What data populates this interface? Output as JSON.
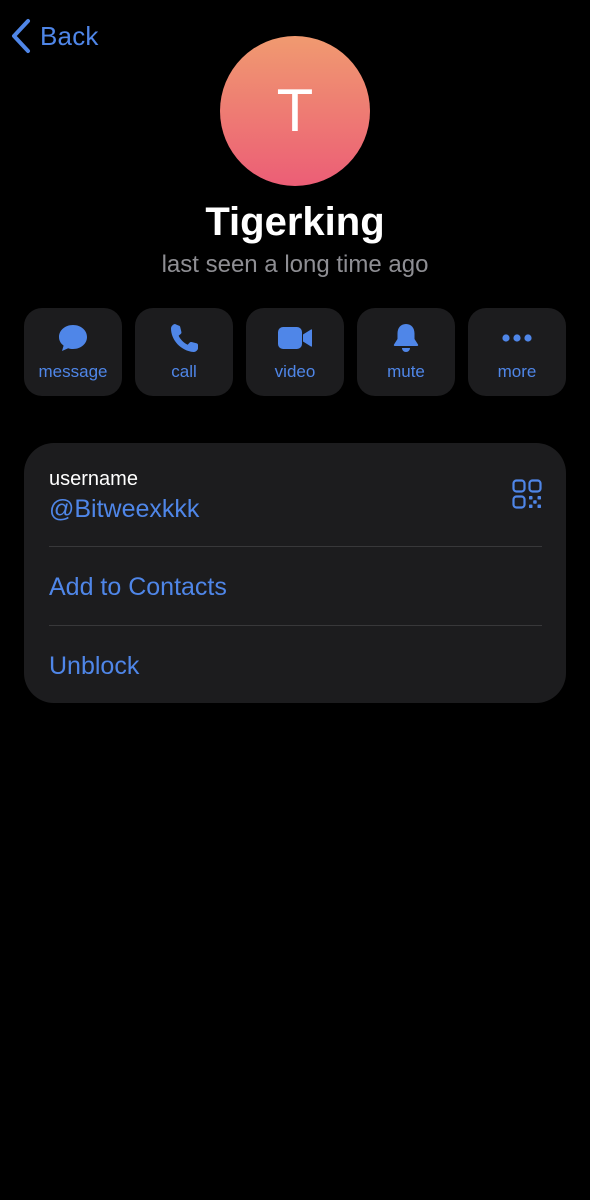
{
  "nav": {
    "back_label": "Back"
  },
  "profile": {
    "avatar_letter": "T",
    "name": "Tigerking",
    "status": "last seen a long time ago"
  },
  "actions": [
    {
      "label": "message",
      "icon": "message-bubble-icon"
    },
    {
      "label": "call",
      "icon": "phone-icon"
    },
    {
      "label": "video",
      "icon": "video-camera-icon"
    },
    {
      "label": "mute",
      "icon": "bell-icon"
    },
    {
      "label": "more",
      "icon": "ellipsis-icon"
    }
  ],
  "info": {
    "username_label": "username",
    "username_value": "@Bitweexkkk",
    "qr_icon": "qr-code-icon",
    "add_contacts_label": "Add to Contacts",
    "unblock_label": "Unblock"
  },
  "colors": {
    "accent": "#4f86e8",
    "background": "#000000",
    "card": "#1c1c1e",
    "secondary_text": "#8e8e93",
    "avatar_gradient_top": "#f09a70",
    "avatar_gradient_bottom": "#ec5e76"
  }
}
